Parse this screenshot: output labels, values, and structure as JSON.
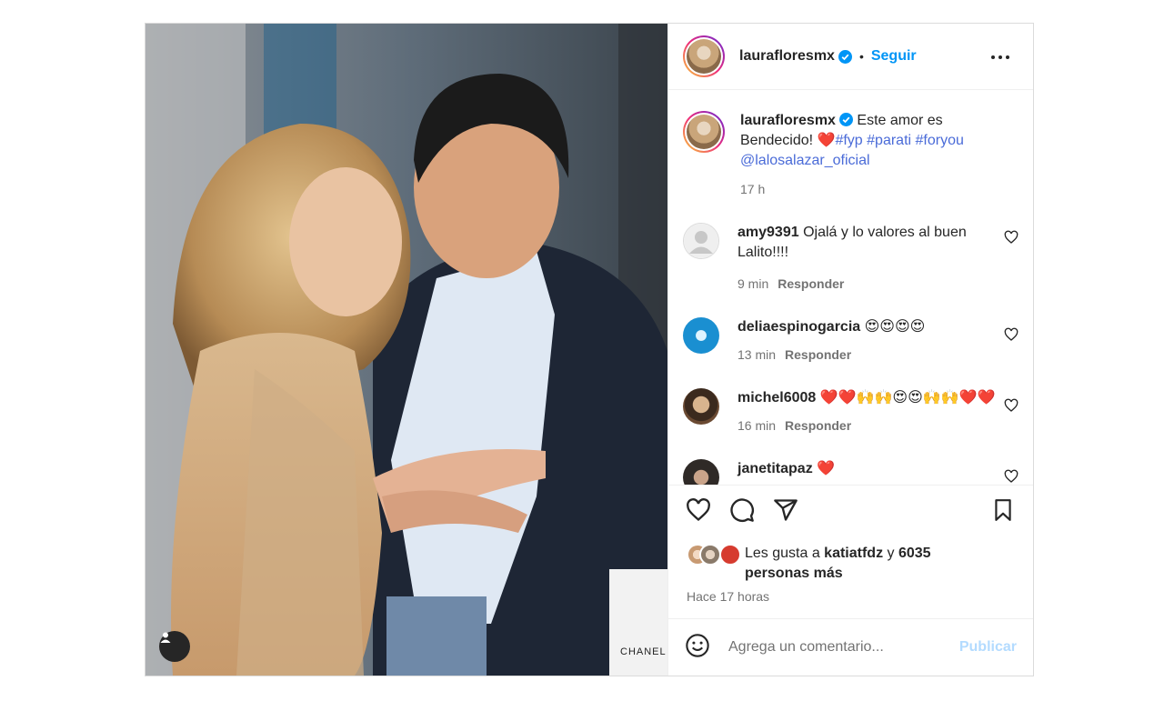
{
  "post": {
    "username": "laurafloresmx",
    "follow_label": "Seguir",
    "dot": "•",
    "caption": {
      "username": "laurafloresmx",
      "text_before": "Este amor es Bendecido! ",
      "heart": "❤️",
      "tags": [
        "#fyp",
        "#parati",
        "#foryou"
      ],
      "mention": "@lalosalazar_oficial",
      "time": "17 h"
    },
    "comments": [
      {
        "username": "amy9391",
        "text": "Ojalá y lo valores al buen Lalito!!!!",
        "time": "9 min",
        "reply": "Responder",
        "avatar_color": "#dbdbdb"
      },
      {
        "username": "deliaespinogarcia",
        "text": "😍😍😍😍",
        "time": "13 min",
        "reply": "Responder",
        "avatar_color": "#1a8fd1"
      },
      {
        "username": "michel6008",
        "text": "❤️❤️🙌🙌😍😍🙌🙌❤️❤️",
        "time": "16 min",
        "reply": "Responder",
        "avatar_color": "#6b4a32"
      },
      {
        "username": "janetitapaz",
        "text": "❤️",
        "time": "",
        "reply": "",
        "avatar_color": "#3a3a3a"
      }
    ],
    "likes": {
      "prefix": "Les gusta a ",
      "liker": "katiatfdz",
      "mid": " y ",
      "count": "6035",
      "suffix": "personas más"
    },
    "posted": "Hace 17 horas",
    "comment_placeholder": "Agrega un comentario...",
    "publish_label": "Publicar",
    "photo_text": "CHANEL"
  },
  "icons": [
    "more-icon",
    "heart-icon",
    "comment-icon",
    "share-icon",
    "save-icon",
    "emoji-icon",
    "user-tag-icon",
    "verified-icon"
  ],
  "colors": {
    "accent": "#0095f6",
    "link": "#4a6bd8",
    "muted": "#737373",
    "publish_disabled": "#b3dbff"
  }
}
